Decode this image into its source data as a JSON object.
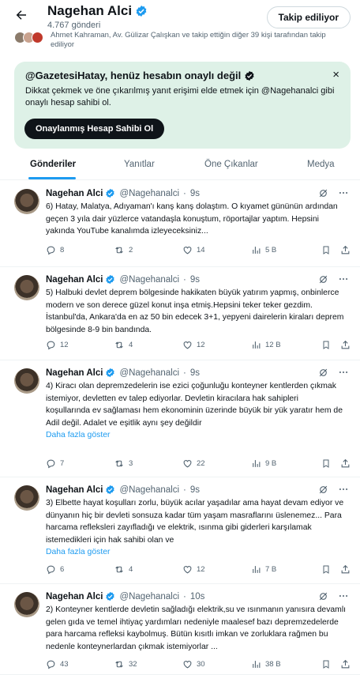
{
  "header": {
    "name": "Nagehan Alci",
    "post_count": "4.767 gönderi",
    "follow_button": "Takip ediliyor",
    "followers_text": "Ahmet Kahraman, Av. Gülizar Çalışkan ve takip ettiğin diğer 39 kişi tarafından takip ediliyor"
  },
  "banner": {
    "title": "@GazetesiHatay, henüz hesabın onaylı değil",
    "text": "Dikkat çekmek ve öne çıkarılmış yanıt erişimi elde etmek için @Nagehanalci gibi onaylı hesap sahibi ol.",
    "button": "Onaylanmış Hesap Sahibi Ol",
    "close": "×"
  },
  "tabs": [
    "Gönderiler",
    "Yanıtlar",
    "Öne Çıkanlar",
    "Medya"
  ],
  "tweets": [
    {
      "name": "Nagehan Alci",
      "handle": "@Nagehanalci",
      "sep": "·",
      "time": "9s",
      "text": "6) Hatay, Malatya, Adıyaman'ı kanş kanş dolaştım. O kıyamet gününün ardından geçen 3 yıla dair yüzlerce vatandaşla konuştum, röportajlar yaptım. Hepsini yakında YouTube kanalımda izleyeceksiniz...",
      "more": "",
      "replies": "8",
      "reposts": "2",
      "likes": "14",
      "views": "5 B"
    },
    {
      "name": "Nagehan Alci",
      "handle": "@Nagehanalci",
      "sep": "·",
      "time": "9s",
      "text": "5) Halbuki devlet deprem bölgesinde hakikaten büyük yatırım yapmış, onbinlerce modern ve son derece güzel konut inşa etmiş.Hepsini teker teker gezdim. İstanbul'da, Ankara'da en az 50 bin edecek 3+1, yepyeni dairelerin kiraları deprem bölgesinde 8-9 bin bandında.",
      "more": "",
      "replies": "12",
      "reposts": "4",
      "likes": "12",
      "views": "12 B"
    },
    {
      "name": "Nagehan Alci",
      "handle": "@Nagehanalci",
      "sep": "·",
      "time": "9s",
      "text": "4) Kiracı olan depremzedelerin ise ezici çoğunluğu konteyner kentlerden çıkmak istemiyor, devletten ev talep ediyorlar. Devletin kiracılara hak sahipleri\nkoşullarında ev sağlaması hem ekonominin üzerinde büyük bir yük yaratır hem de Adil değil. Adalet ve eşitlik aynı şey değildir",
      "more": "Daha fazla göster",
      "replies": "7",
      "reposts": "3",
      "likes": "22",
      "views": "9 B"
    },
    {
      "name": "Nagehan Alci",
      "handle": "@Nagehanalci",
      "sep": "·",
      "time": "9s",
      "text": "3) Elbette hayat koşulları zorlu, büyük acılar yaşadılar ama hayat devam ediyor ve dünyanın hiç bir devleti sonsuza kadar tüm yaşam masraflarını üslenemez... Para harcama refleksleri zayıfladığı ve elektrik, ısınma gibi giderleri karşılamak istemedikleri için hak sahibi olan ve",
      "more": "Daha fazla göster",
      "replies": "6",
      "reposts": "4",
      "likes": "12",
      "views": "7 B"
    },
    {
      "name": "Nagehan Alci",
      "handle": "@Nagehanalci",
      "sep": "·",
      "time": "10s",
      "text": "2) Konteyner kentlerde devletin  sağladığı elektrik,su ve ısınmanın yanısıra devamlı gelen gıda ve temel ihtiyaç yardımları nedeniyle maalesef bazı depremzedelerde para harcama refleksi kaybolmuş. Bütün kısıtlı imkan ve zorluklara rağmen bu nedenle konteynerlardan çıkmak istemiyorlar ...",
      "more": "",
      "replies": "43",
      "reposts": "32",
      "likes": "30",
      "views": "38 B"
    }
  ],
  "colors": {
    "accent": "#1d9bf0",
    "banner_bg": "#def1e7",
    "text": "#0f1419",
    "muted": "#536471"
  },
  "icons": [
    "back-arrow-icon",
    "verified-badge-icon",
    "close-icon",
    "grok-icon",
    "more-icon",
    "reply-icon",
    "repost-icon",
    "like-icon",
    "views-icon",
    "bookmark-icon",
    "share-icon"
  ]
}
